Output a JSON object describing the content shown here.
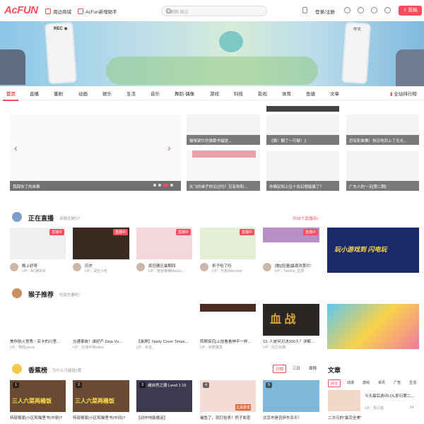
{
  "header": {
    "logo": "AcFUN",
    "links": [
      "周边商城",
      "AcFun新增助手"
    ],
    "search_placeholder": "大鹅鹅 周边",
    "login": "登录/注册",
    "submit": "投稿"
  },
  "banner": {
    "rec": "REC ◉",
    "label": "中文"
  },
  "nav": {
    "items": [
      "首页",
      "直播",
      "番剧",
      "动画",
      "娱乐",
      "生活",
      "音乐",
      "舞蹈·偶像",
      "游戏",
      "科技",
      "影视",
      "体育",
      "鱼塘",
      "文章"
    ],
    "rank": "全站排行榜"
  },
  "hero": {
    "main_caption": "我踩你了的弟事",
    "tiles": [
      "猫咪紧忙的弹幕书福提→",
      "《猫！翻了～可疑！》",
      "恐有影象舞！恢议地同上了无光…",
      "去飞的弟子你见过吗？见有你和…",
      "你确定知上位十兆幻想能赢了？",
      "广东人的一天[第二期]"
    ]
  },
  "live": {
    "title": "正在直播",
    "subtitle": "来报还是D?",
    "more": "共58个直播间>",
    "badge": "直播中",
    "items": [
      {
        "title": "晚上好呀",
        "up": "UP：AC潮本体"
      },
      {
        "title": "历史",
        "up": "UP：深空小吃"
      },
      {
        "title": "疯狂搬迁最期四",
        "up": "UP：雨音嘟嘟Merisu…"
      },
      {
        "title": "折子哈了吗",
        "up": "UP：光板Welcome"
      },
      {
        "title": "[歌][轻量]最喜欢那片!",
        "up": "UP：Twinkle_星辰"
      }
    ],
    "ad": "玩小游戏到 闪电玩"
  },
  "monkey": {
    "title": "猴子推荐",
    "subtitle": "吃饭先要吃！",
    "items": [
      {
        "title": "美伴航火意秀・实卡的川里…",
        "up": "UP：物经yarnis"
      },
      {
        "title": "交通事故！谁好产 Deja Vu…",
        "up": "UP：交通半柄video"
      },
      {
        "title": "【录屏】Nasty Cover Timas…",
        "up": "UP：余音_"
      },
      {
        "title": "转颗探究|上挂看看神不一样…",
        "up": "UP：转颗猪发"
      },
      {
        "title": "13. 人是何对决300人？详解…",
        "up": "UP：社区标确"
      }
    ],
    "poster_text": "血 战"
  },
  "banana": {
    "title": "香蕉榜",
    "subtitle": "为什么只能投5蕉",
    "tabs": [
      "日榜",
      "三日",
      "周榜"
    ],
    "items": [
      {
        "rank": "1",
        "title": "特部报家|小区和猫里书(中册)?",
        "img": "三人六菜两桶饭"
      },
      {
        "rank": "2",
        "title": "特部报家|小区和猫里书(中间)?",
        "img": "三人六菜两桶饭"
      },
      {
        "rank": "3",
        "title": "【动作地能播话】",
        "img": "雌自然之器 Level 1 15"
      },
      {
        "rank": "4",
        "title": "捕鱼了，就打抬表！奶子凯密",
        "img": "五黑春害"
      },
      {
        "rank": "5",
        "title": "北京市是否伊东杀乐！",
        "img": ""
      }
    ]
  },
  "articles": {
    "title": "文章",
    "tabs": [
      "综合",
      "动漫",
      "游戏",
      "资讯",
      "广告",
      "生活"
    ],
    "items": [
      {
        "title": "今天最后游评LOL即日第二…",
        "up": "UP：零凸笔"
      },
      {
        "title": "二次元的\"最完全美\"",
        "up": ""
      }
    ],
    "count": "54"
  },
  "colors": {
    "accent": "#fd4c5d"
  }
}
